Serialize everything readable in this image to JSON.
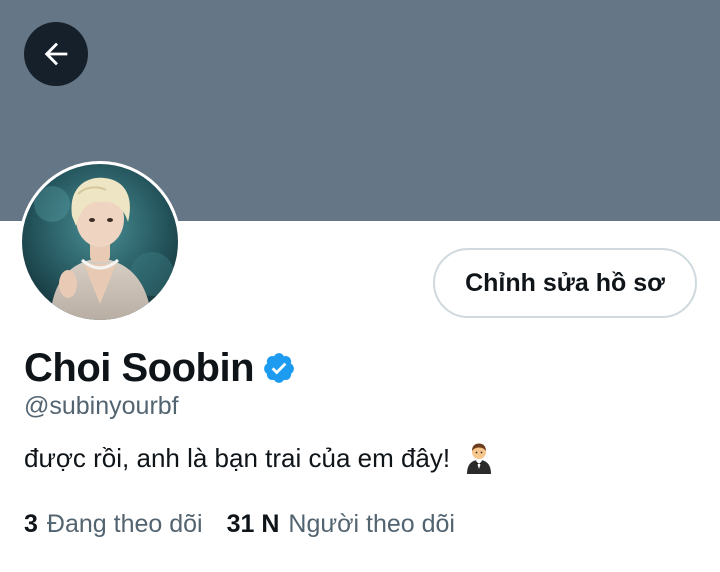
{
  "profile": {
    "display_name": "Choi Soobin",
    "handle": "@subinyourbf",
    "bio": "được rồi, anh là bạn trai của em đây!",
    "bio_emoji": "person-in-tuxedo-icon",
    "verified": true,
    "edit_button_label": "Chỉnh sửa hồ sơ"
  },
  "stats": {
    "following_count": "3",
    "following_label": "Đang theo dõi",
    "followers_count": "31 N",
    "followers_label": "Người theo dõi"
  },
  "colors": {
    "banner": "#657786",
    "verified_blue": "#1d9bf0",
    "text_primary": "#0f1419",
    "text_secondary": "#536471",
    "button_border": "#cfd9de"
  },
  "icons": {
    "back": "arrow-left-icon",
    "verified": "verified-badge-icon"
  }
}
